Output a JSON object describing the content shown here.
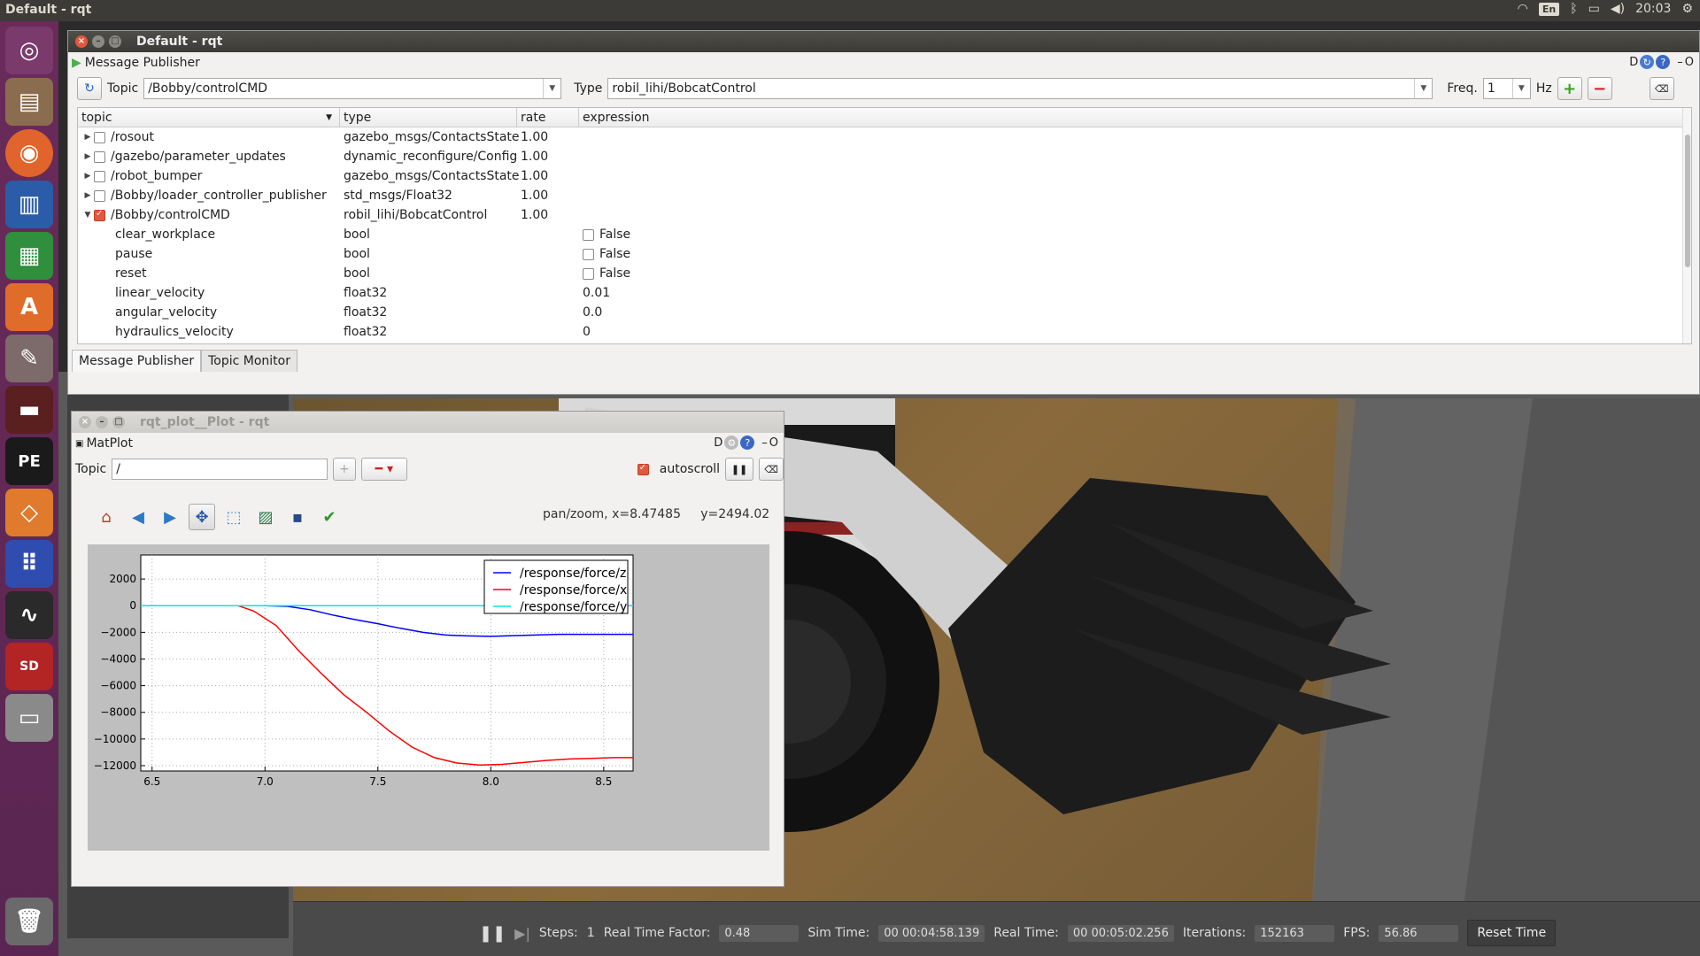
{
  "top_panel": {
    "title": "Default - rqt",
    "lang": "En",
    "time": "20:03"
  },
  "rqt_window": {
    "title": "Default - rqt",
    "plugin_name": "Message Publisher",
    "topic_label": "Topic",
    "topic_value": "/Bobby/controlCMD",
    "type_label": "Type",
    "type_value": "robil_lihi/BobcatControl",
    "freq_label": "Freq.",
    "freq_value": "1",
    "hz_label": "Hz",
    "columns": [
      "topic",
      "type",
      "rate",
      "expression"
    ],
    "rows": [
      {
        "topic": "/rosout",
        "type": "gazebo_msgs/ContactsState",
        "rate": "1.00",
        "checked": false,
        "expanded": false
      },
      {
        "topic": "/gazebo/parameter_updates",
        "type": "dynamic_reconfigure/Config",
        "rate": "1.00",
        "checked": false,
        "expanded": false
      },
      {
        "topic": "/robot_bumper",
        "type": "gazebo_msgs/ContactsState",
        "rate": "1.00",
        "checked": false,
        "expanded": false
      },
      {
        "topic": "/Bobby/loader_controller_publisher",
        "type": "std_msgs/Float32",
        "rate": "1.00",
        "checked": false,
        "expanded": false
      },
      {
        "topic": "/Bobby/controlCMD",
        "type": "robil_lihi/BobcatControl",
        "rate": "1.00",
        "checked": true,
        "expanded": true
      }
    ],
    "fields": [
      {
        "name": "clear_workplace",
        "type": "bool",
        "expr": "False",
        "is_bool": true
      },
      {
        "name": "pause",
        "type": "bool",
        "expr": "False",
        "is_bool": true
      },
      {
        "name": "reset",
        "type": "bool",
        "expr": "False",
        "is_bool": true
      },
      {
        "name": "linear_velocity",
        "type": "float32",
        "expr": "0.01",
        "is_bool": false
      },
      {
        "name": "angular_velocity",
        "type": "float32",
        "expr": "0.0",
        "is_bool": false
      },
      {
        "name": "hydraulics_velocity",
        "type": "float32",
        "expr": "0",
        "is_bool": false
      }
    ],
    "tabs": [
      "Message Publisher",
      "Topic Monitor"
    ]
  },
  "plot_window": {
    "title": "rqt_plot__Plot - rqt",
    "plugin_name": "MatPlot",
    "topic_label": "Topic",
    "topic_value": "/",
    "autoscroll_label": "autoscroll",
    "autoscroll_checked": true,
    "coords_text": "pan/zoom, x=8.47485     y=2494.02"
  },
  "gazebo": {
    "steps_label": "Steps:",
    "steps_value": "1",
    "rtf_label": "Real Time Factor:",
    "rtf_value": "0.48",
    "sim_time_label": "Sim Time:",
    "sim_time_value": "00 00:04:58.139",
    "real_time_label": "Real Time:",
    "real_time_value": "00 00:05:02.256",
    "iterations_label": "Iterations:",
    "iterations_value": "152163",
    "fps_label": "FPS:",
    "fps_value": "56.86",
    "reset_label": "Reset Time"
  },
  "chart_data": {
    "type": "line",
    "xlim": [
      6.45,
      8.63
    ],
    "ylim": [
      -12400,
      3800
    ],
    "xticks": [
      6.5,
      7.0,
      7.5,
      8.0,
      8.5
    ],
    "xtick_labels": [
      "6.5",
      "7.0",
      "7.5",
      "8.0",
      "8.5"
    ],
    "yticks": [
      2000,
      0,
      -2000,
      -4000,
      -6000,
      -8000,
      -10000,
      -12000
    ],
    "ytick_labels": [
      "2000",
      "0",
      "−2000",
      "−4000",
      "−6000",
      "−8000",
      "−10000",
      "−12000"
    ],
    "grid": true,
    "legend_position": "top-right",
    "series": [
      {
        "name": "/response/force/z",
        "color": "#0000ff",
        "x": [
          6.45,
          7.0,
          7.1,
          7.2,
          7.3,
          7.4,
          7.5,
          7.6,
          7.7,
          7.8,
          7.9,
          8.0,
          8.1,
          8.2,
          8.3,
          8.4,
          8.5,
          8.63
        ],
        "y": [
          0,
          0,
          -50,
          -300,
          -700,
          -1050,
          -1350,
          -1700,
          -2000,
          -2200,
          -2270,
          -2300,
          -2250,
          -2200,
          -2150,
          -2150,
          -2150,
          -2150
        ]
      },
      {
        "name": "/response/force/x",
        "color": "#ff0000",
        "x": [
          6.45,
          6.88,
          6.95,
          7.05,
          7.15,
          7.25,
          7.35,
          7.45,
          7.55,
          7.65,
          7.75,
          7.85,
          7.95,
          8.05,
          8.15,
          8.25,
          8.35,
          8.45,
          8.55,
          8.63
        ],
        "y": [
          0,
          0,
          -400,
          -1500,
          -3400,
          -5100,
          -6700,
          -8000,
          -9400,
          -10600,
          -11400,
          -11800,
          -11950,
          -11900,
          -11750,
          -11600,
          -11500,
          -11450,
          -11400,
          -11400
        ]
      },
      {
        "name": "/response/force/y",
        "color": "#00e5e5",
        "x": [
          6.45,
          8.63
        ],
        "y": [
          0,
          0
        ]
      }
    ]
  }
}
